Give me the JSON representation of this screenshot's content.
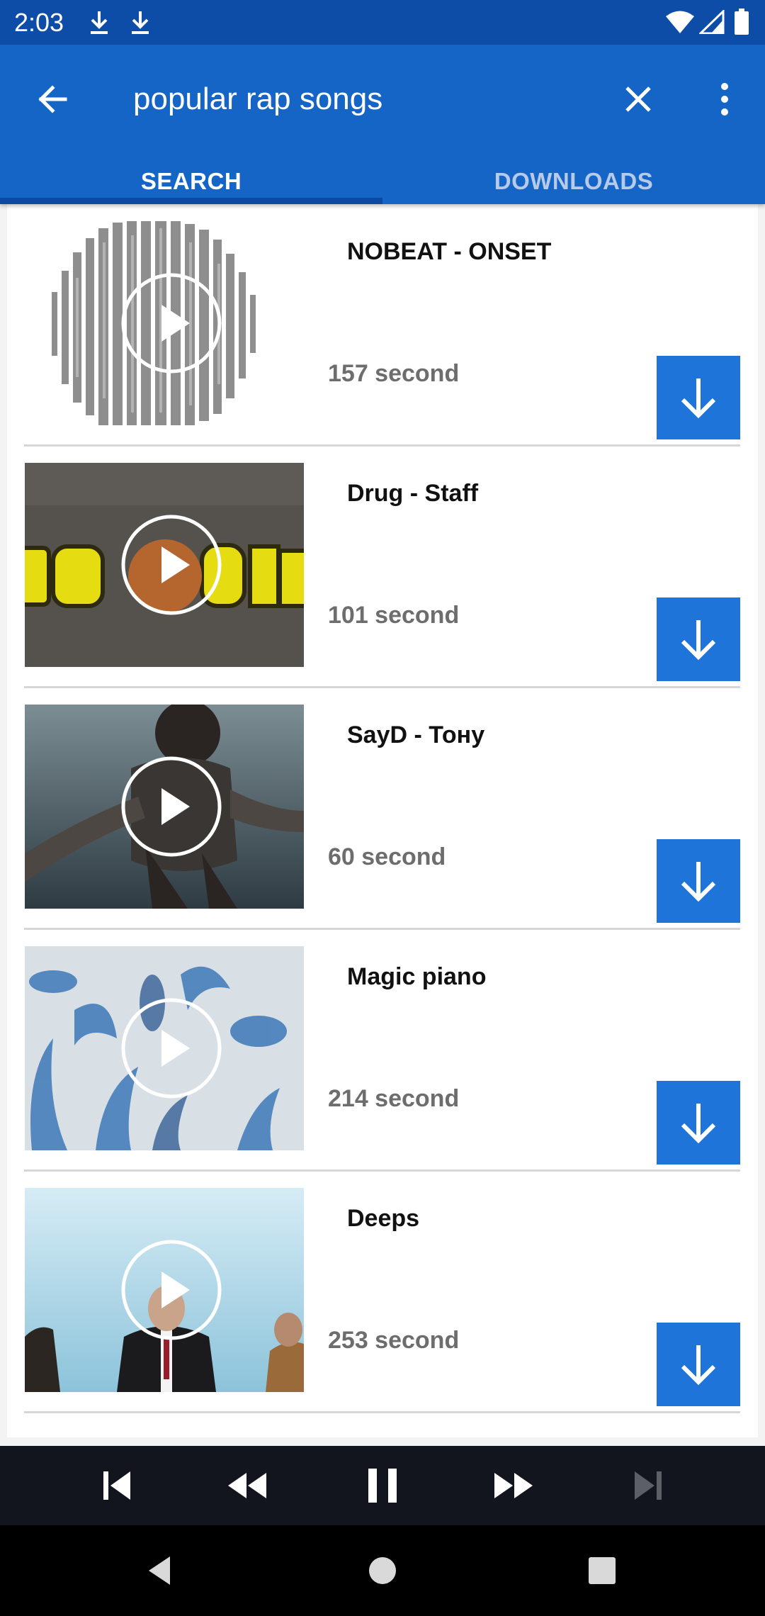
{
  "status_bar": {
    "time": "2:03",
    "icons": [
      "download-icon",
      "download-icon",
      "wifi-icon",
      "signal-icon",
      "battery-icon"
    ]
  },
  "app_bar": {
    "search_query": "popular rap songs",
    "back_icon": "arrow-left-icon",
    "clear_icon": "close-icon",
    "menu_icon": "more-vert-icon",
    "tabs": [
      {
        "label": "SEARCH",
        "selected": true
      },
      {
        "label": "DOWNLOADS",
        "selected": false
      }
    ]
  },
  "results": [
    {
      "title": "NOBEAT - ONSET",
      "duration": "157 second",
      "thumbnail": "abstract-gray-stripes"
    },
    {
      "title": "Drug - Staff",
      "duration": "101 second",
      "thumbnail": "yellow-text-on-gray"
    },
    {
      "title": "SayD - Тону",
      "duration": "60 second",
      "thumbnail": "diver-in-water"
    },
    {
      "title": "Magic piano",
      "duration": "214 second",
      "thumbnail": "blue-painting-digital-music"
    },
    {
      "title": "Deeps",
      "duration": "253 second",
      "thumbnail": "men-at-sea"
    }
  ],
  "player_controls": [
    "skip-previous-icon",
    "rewind-icon",
    "pause-icon",
    "fast-forward-icon",
    "skip-next-icon"
  ],
  "nav_bar": [
    "back-triangle-icon",
    "home-circle-icon",
    "recents-square-icon"
  ],
  "colors": {
    "status_bar": "#0d4da8",
    "app_bar": "#1565c7",
    "download_button": "#1e74d8",
    "player_bar": "#12151d"
  }
}
